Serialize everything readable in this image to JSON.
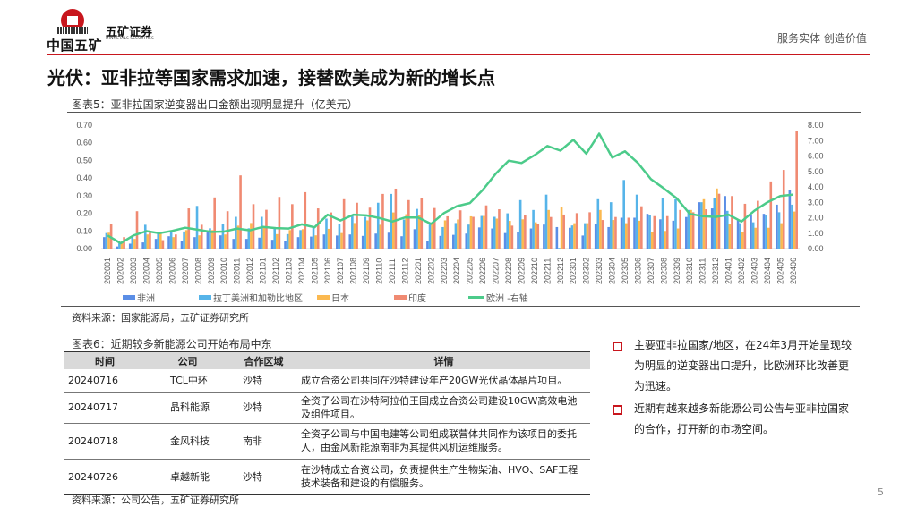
{
  "header": {
    "logo_group": "中国五矿",
    "logo_brand": "五矿证券",
    "logo_sub": "MINMETALS SECURITIES",
    "slogan": "服务实体  创造价值"
  },
  "title": "光伏：亚非拉等国家需求加速，接替欧美成为新的增长点",
  "figure5": {
    "caption": "图表5：亚非拉国家逆变器出口金额出现明显提升（亿美元）",
    "source": "资料来源：国家能源局，五矿证券研究所"
  },
  "chart_data": {
    "type": "bar",
    "title": "图表5：亚非拉国家逆变器出口金额出现明显提升（亿美元）",
    "ylim": [
      0,
      0.7
    ],
    "ylim_right": [
      0,
      8
    ],
    "yticks": [
      "0.00",
      "0.10",
      "0.20",
      "0.30",
      "0.40",
      "0.50",
      "0.60",
      "0.70"
    ],
    "yticks_right": [
      "0.00",
      "1.00",
      "2.00",
      "3.00",
      "4.00",
      "5.00",
      "6.00",
      "7.00",
      "8.00"
    ],
    "legend_position": "bottom",
    "categories": [
      "202001",
      "202002",
      "202003",
      "202004",
      "202005",
      "202006",
      "202007",
      "202008",
      "202009",
      "202010",
      "202011",
      "202012",
      "202101",
      "202102",
      "202103",
      "202104",
      "202105",
      "202106",
      "202107",
      "202108",
      "202109",
      "202110",
      "202111",
      "202112",
      "202201",
      "202202",
      "202203",
      "202204",
      "202205",
      "202206",
      "202207",
      "202208",
      "202209",
      "202210",
      "202211",
      "202212",
      "202301",
      "202302",
      "202303",
      "202304",
      "202305",
      "202306",
      "202307",
      "202308",
      "202309",
      "202310",
      "202311",
      "202312",
      "202401",
      "202402",
      "202403",
      "202404",
      "202405",
      "202406"
    ],
    "series": [
      {
        "name": "非洲",
        "type": "bar",
        "axis": "left",
        "color": "#5b8ee6",
        "values": [
          0.065,
          0.012,
          0.028,
          0.035,
          0.055,
          0.07,
          0.043,
          0.065,
          0.1,
          0.075,
          0.055,
          0.055,
          0.062,
          0.05,
          0.045,
          0.065,
          0.068,
          0.08,
          0.074,
          0.08,
          0.072,
          0.085,
          0.09,
          0.07,
          0.11,
          0.045,
          0.072,
          0.078,
          0.085,
          0.12,
          0.114,
          0.088,
          0.092,
          0.114,
          0.136,
          0.122,
          0.118,
          0.074,
          0.14,
          0.122,
          0.175,
          0.175,
          0.197,
          0.166,
          0.158,
          0.179,
          0.263,
          0.228,
          0.298,
          0.162,
          0.193,
          0.197,
          0.249,
          0.333
        ]
      },
      {
        "name": "拉丁美洲和加勒比地区",
        "type": "bar",
        "axis": "left",
        "color": "#56b4e9",
        "values": [
          0.088,
          0.03,
          0.065,
          0.135,
          0.09,
          0.1,
          0.097,
          0.242,
          0.115,
          0.14,
          0.18,
          0.115,
          0.18,
          0.12,
          0.082,
          0.105,
          0.12,
          0.17,
          0.14,
          0.19,
          0.18,
          0.26,
          0.31,
          0.165,
          0.225,
          0.14,
          0.122,
          0.145,
          0.136,
          0.185,
          0.18,
          0.2,
          0.275,
          0.219,
          0.306,
          0.004,
          0.131,
          0.144,
          0.28,
          0.263,
          0.389,
          0.306,
          0.188,
          0.289,
          0.28,
          0.219,
          0.263,
          0.289,
          0.214,
          0.144,
          0.149,
          0.188,
          0.206,
          0.249
        ]
      },
      {
        "name": "日本",
        "type": "bar",
        "axis": "left",
        "color": "#fbb950",
        "values": [
          0.09,
          0.03,
          0.055,
          0.08,
          0.09,
          0.065,
          0.105,
          0.075,
          0.105,
          0.08,
          0.13,
          0.145,
          0.12,
          0.082,
          0.105,
          0.11,
          0.075,
          0.112,
          0.088,
          0.145,
          0.16,
          0.135,
          0.205,
          0.195,
          0.19,
          0.14,
          0.16,
          0.165,
          0.183,
          0.185,
          0.17,
          0.157,
          0.166,
          0.149,
          0.219,
          0.236,
          0.144,
          0.144,
          0.219,
          0.162,
          0.144,
          0.158,
          0.092,
          0.1,
          0.114,
          0.219,
          0.28,
          0.341,
          0.14,
          0.096,
          0.118,
          0.118,
          0.144,
          0.21
        ]
      },
      {
        "name": "印度",
        "type": "bar",
        "axis": "left",
        "color": "#f08a72",
        "values": [
          0.137,
          0.065,
          0.212,
          0.09,
          0.048,
          0.08,
          0.228,
          0.135,
          0.29,
          0.212,
          0.415,
          0.252,
          0.22,
          0.293,
          0.252,
          0.32,
          0.228,
          0.205,
          0.28,
          0.26,
          0.232,
          0.31,
          0.34,
          0.275,
          0.288,
          0.23,
          0.183,
          0.217,
          0.18,
          0.245,
          0.223,
          0.13,
          0.188,
          0.14,
          0.179,
          0.193,
          0.201,
          0.206,
          0.162,
          0.179,
          0.175,
          0.24,
          0.184,
          0.184,
          0.219,
          0.206,
          0.223,
          0.311,
          0.298,
          0.254,
          0.271,
          0.381,
          0.446,
          0.665
        ]
      },
      {
        "name": "欧洲 -右轴",
        "type": "line",
        "axis": "right",
        "color": "#4ccb8a",
        "values": [
          0.85,
          0.35,
          0.85,
          1.13,
          1.0,
          1.15,
          1.35,
          1.22,
          1.08,
          1.1,
          1.3,
          1.18,
          1.4,
          1.33,
          1.3,
          1.57,
          1.38,
          2.2,
          1.82,
          2.2,
          2.15,
          1.98,
          1.75,
          2.02,
          2.02,
          1.6,
          2.3,
          2.75,
          2.95,
          3.8,
          4.85,
          5.7,
          5.55,
          6.05,
          6.65,
          6.35,
          7.05,
          6.15,
          7.45,
          5.9,
          6.3,
          5.55,
          4.5,
          3.9,
          3.25,
          2.25,
          2.1,
          2.05,
          2.2,
          1.75,
          2.45,
          3.0,
          3.4,
          3.5
        ]
      }
    ]
  },
  "figure6": {
    "caption": "图表6：近期较多新能源公司开始布局中东",
    "headers": [
      "时间",
      "公司",
      "合作区域",
      "详情"
    ],
    "rows": [
      [
        "20240716",
        "TCL中环",
        "沙特",
        "成立合资公司共同在沙特建设年产20GW光伏晶体晶片项目。"
      ],
      [
        "20240717",
        "晶科能源",
        "沙特",
        "全资子公司在沙特阿拉伯王国成立合资公司建设10GW高效电池及组件项目。"
      ],
      [
        "20240718",
        "金风科技",
        "南非",
        "全资子公司与中国电建等公司组成联营体共同作为该项目的委托人，由金风新能源南非为其提供风机运维服务。"
      ],
      [
        "20240726",
        "卓越新能",
        "沙特",
        "在沙特成立合资公司，负责提供生产生物柴油、HVO、SAF工程技术装备和建设的有偿服务。"
      ]
    ],
    "source": "资料来源：公司公告，五矿证券研究所"
  },
  "bullets": [
    "主要亚非拉国家/地区，在24年3月开始呈现较为明显的逆变器出口提升，比欧洲环比改善更为迅速。",
    "近期有越来越多新能源公司公告与亚非拉国家的合作，打开新的市场空间。"
  ],
  "page_number": "5"
}
